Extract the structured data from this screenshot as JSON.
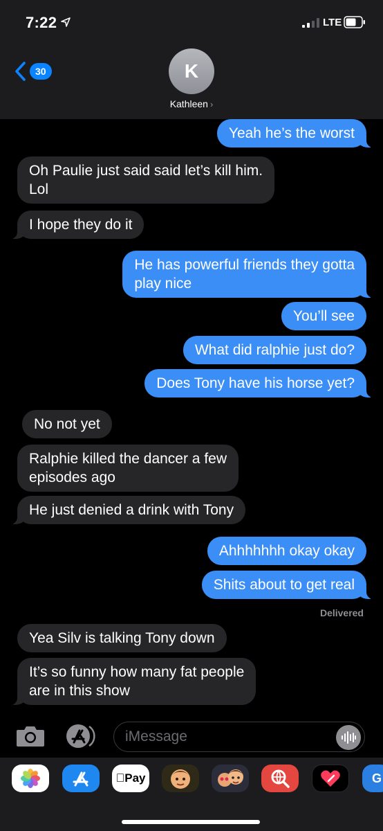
{
  "status_bar": {
    "time": "7:22",
    "network": "LTE"
  },
  "header": {
    "back_count": "30",
    "avatar_initial": "K",
    "contact_name": "Kathleen"
  },
  "messages": [
    {
      "dir": "out",
      "text": "Yeah he’s the worst"
    },
    {
      "dir": "in",
      "lines": [
        "Oh Paulie just said said let’s kill him.",
        "Lol"
      ]
    },
    {
      "dir": "in",
      "text": "I hope they do it"
    },
    {
      "dir": "out",
      "lines": [
        "He has powerful friends they gotta",
        "play nice"
      ]
    },
    {
      "dir": "out",
      "text": "You’ll see"
    },
    {
      "dir": "out",
      "text": "What did ralphie just do?"
    },
    {
      "dir": "out",
      "text": "Does Tony have his horse yet?"
    },
    {
      "dir": "in",
      "text": "No not yet"
    },
    {
      "dir": "in",
      "lines": [
        "Ralphie killed the dancer a few",
        "episodes ago"
      ]
    },
    {
      "dir": "in",
      "text": "He just denied a drink with Tony"
    },
    {
      "dir": "out",
      "text": "Ahhhhhhh okay okay"
    },
    {
      "dir": "out",
      "text": "Shits about to get real"
    },
    {
      "dir": "in",
      "text": "Yea Silv is talking Tony down"
    },
    {
      "dir": "in",
      "lines": [
        "It’s so funny how many fat people",
        "are in this show"
      ]
    }
  ],
  "delivered_label": "Delivered",
  "composer": {
    "placeholder": "iMessage"
  },
  "app_drawer": [
    {
      "icon": "photos-icon"
    },
    {
      "icon": "app-store-icon"
    },
    {
      "icon": "apple-pay-icon",
      "label": "Pay"
    },
    {
      "icon": "memoji-icon"
    },
    {
      "icon": "memoji-stickers-icon"
    },
    {
      "icon": "web-search-icon"
    },
    {
      "icon": "digital-touch-icon"
    },
    {
      "icon": "giphy-icon",
      "label": "G"
    }
  ]
}
